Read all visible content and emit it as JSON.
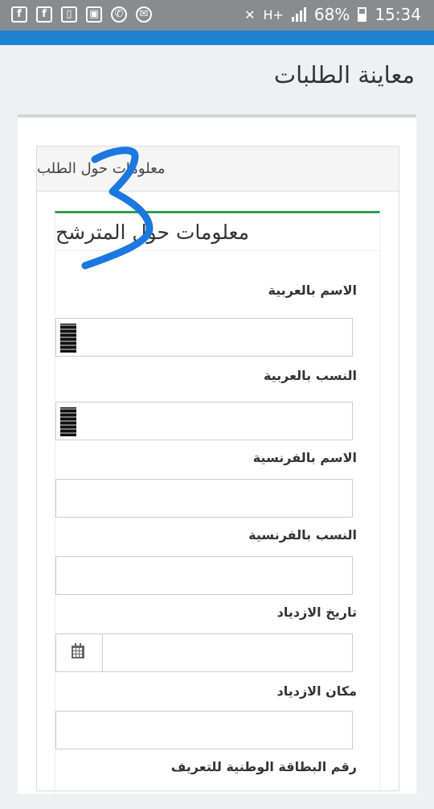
{
  "status_bar": {
    "icons": [
      "facebook-icon",
      "facebook-icon",
      "store-icon",
      "gallery-icon",
      "whatsapp-icon",
      "messenger-icon"
    ],
    "glyphs": [
      "f",
      "f",
      "▯",
      "▣",
      "✆",
      "✉"
    ],
    "network": "H+",
    "battery": "68%",
    "time": "15:34"
  },
  "page": {
    "title": "معاينة الطلبات"
  },
  "request_box": {
    "title": "معلومات حول الطلب"
  },
  "candidate_box": {
    "title": "معلومات حول المترشح",
    "fields": [
      {
        "label": "الاسم بالعربية",
        "value": ""
      },
      {
        "label": "النسب بالعربية",
        "value": ""
      },
      {
        "label": "الاسم بالفرنسية",
        "value": ""
      },
      {
        "label": "النسب بالفرنسية",
        "value": ""
      },
      {
        "label": "تاريخ الازدياد",
        "value": ""
      },
      {
        "label": "مكان الازدياد",
        "value": ""
      },
      {
        "label": "رقم البطاقة الوطنية للتعريف",
        "value": ""
      }
    ]
  },
  "annotation": {
    "text": "3",
    "color": "#1a78e0"
  }
}
